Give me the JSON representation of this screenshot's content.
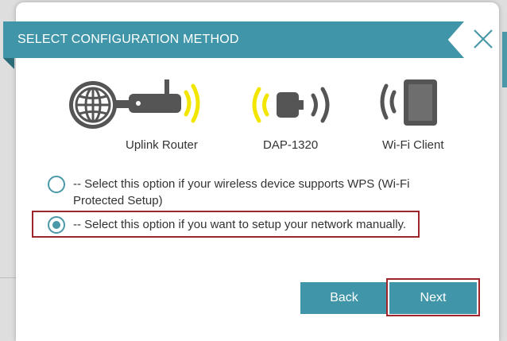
{
  "dialog": {
    "title": "SELECT CONFIGURATION METHOD",
    "close_icon": "close-icon"
  },
  "devices": [
    {
      "label": "Uplink Router",
      "icon": "router-icon"
    },
    {
      "label": "DAP-1320",
      "icon": "extender-icon"
    },
    {
      "label": "Wi-Fi Client",
      "icon": "tablet-icon"
    }
  ],
  "options": [
    {
      "text": "-- Select this option if your wireless device supports WPS (Wi-Fi Protected Setup)",
      "selected": false
    },
    {
      "text": "-- Select this option if you want to setup your network manually.",
      "selected": true
    }
  ],
  "buttons": {
    "back": "Back",
    "next": "Next"
  },
  "colors": {
    "accent": "#4096a8",
    "highlight": "#a0262e",
    "wifi_active": "#f2e600",
    "icon_gray": "#555555"
  }
}
